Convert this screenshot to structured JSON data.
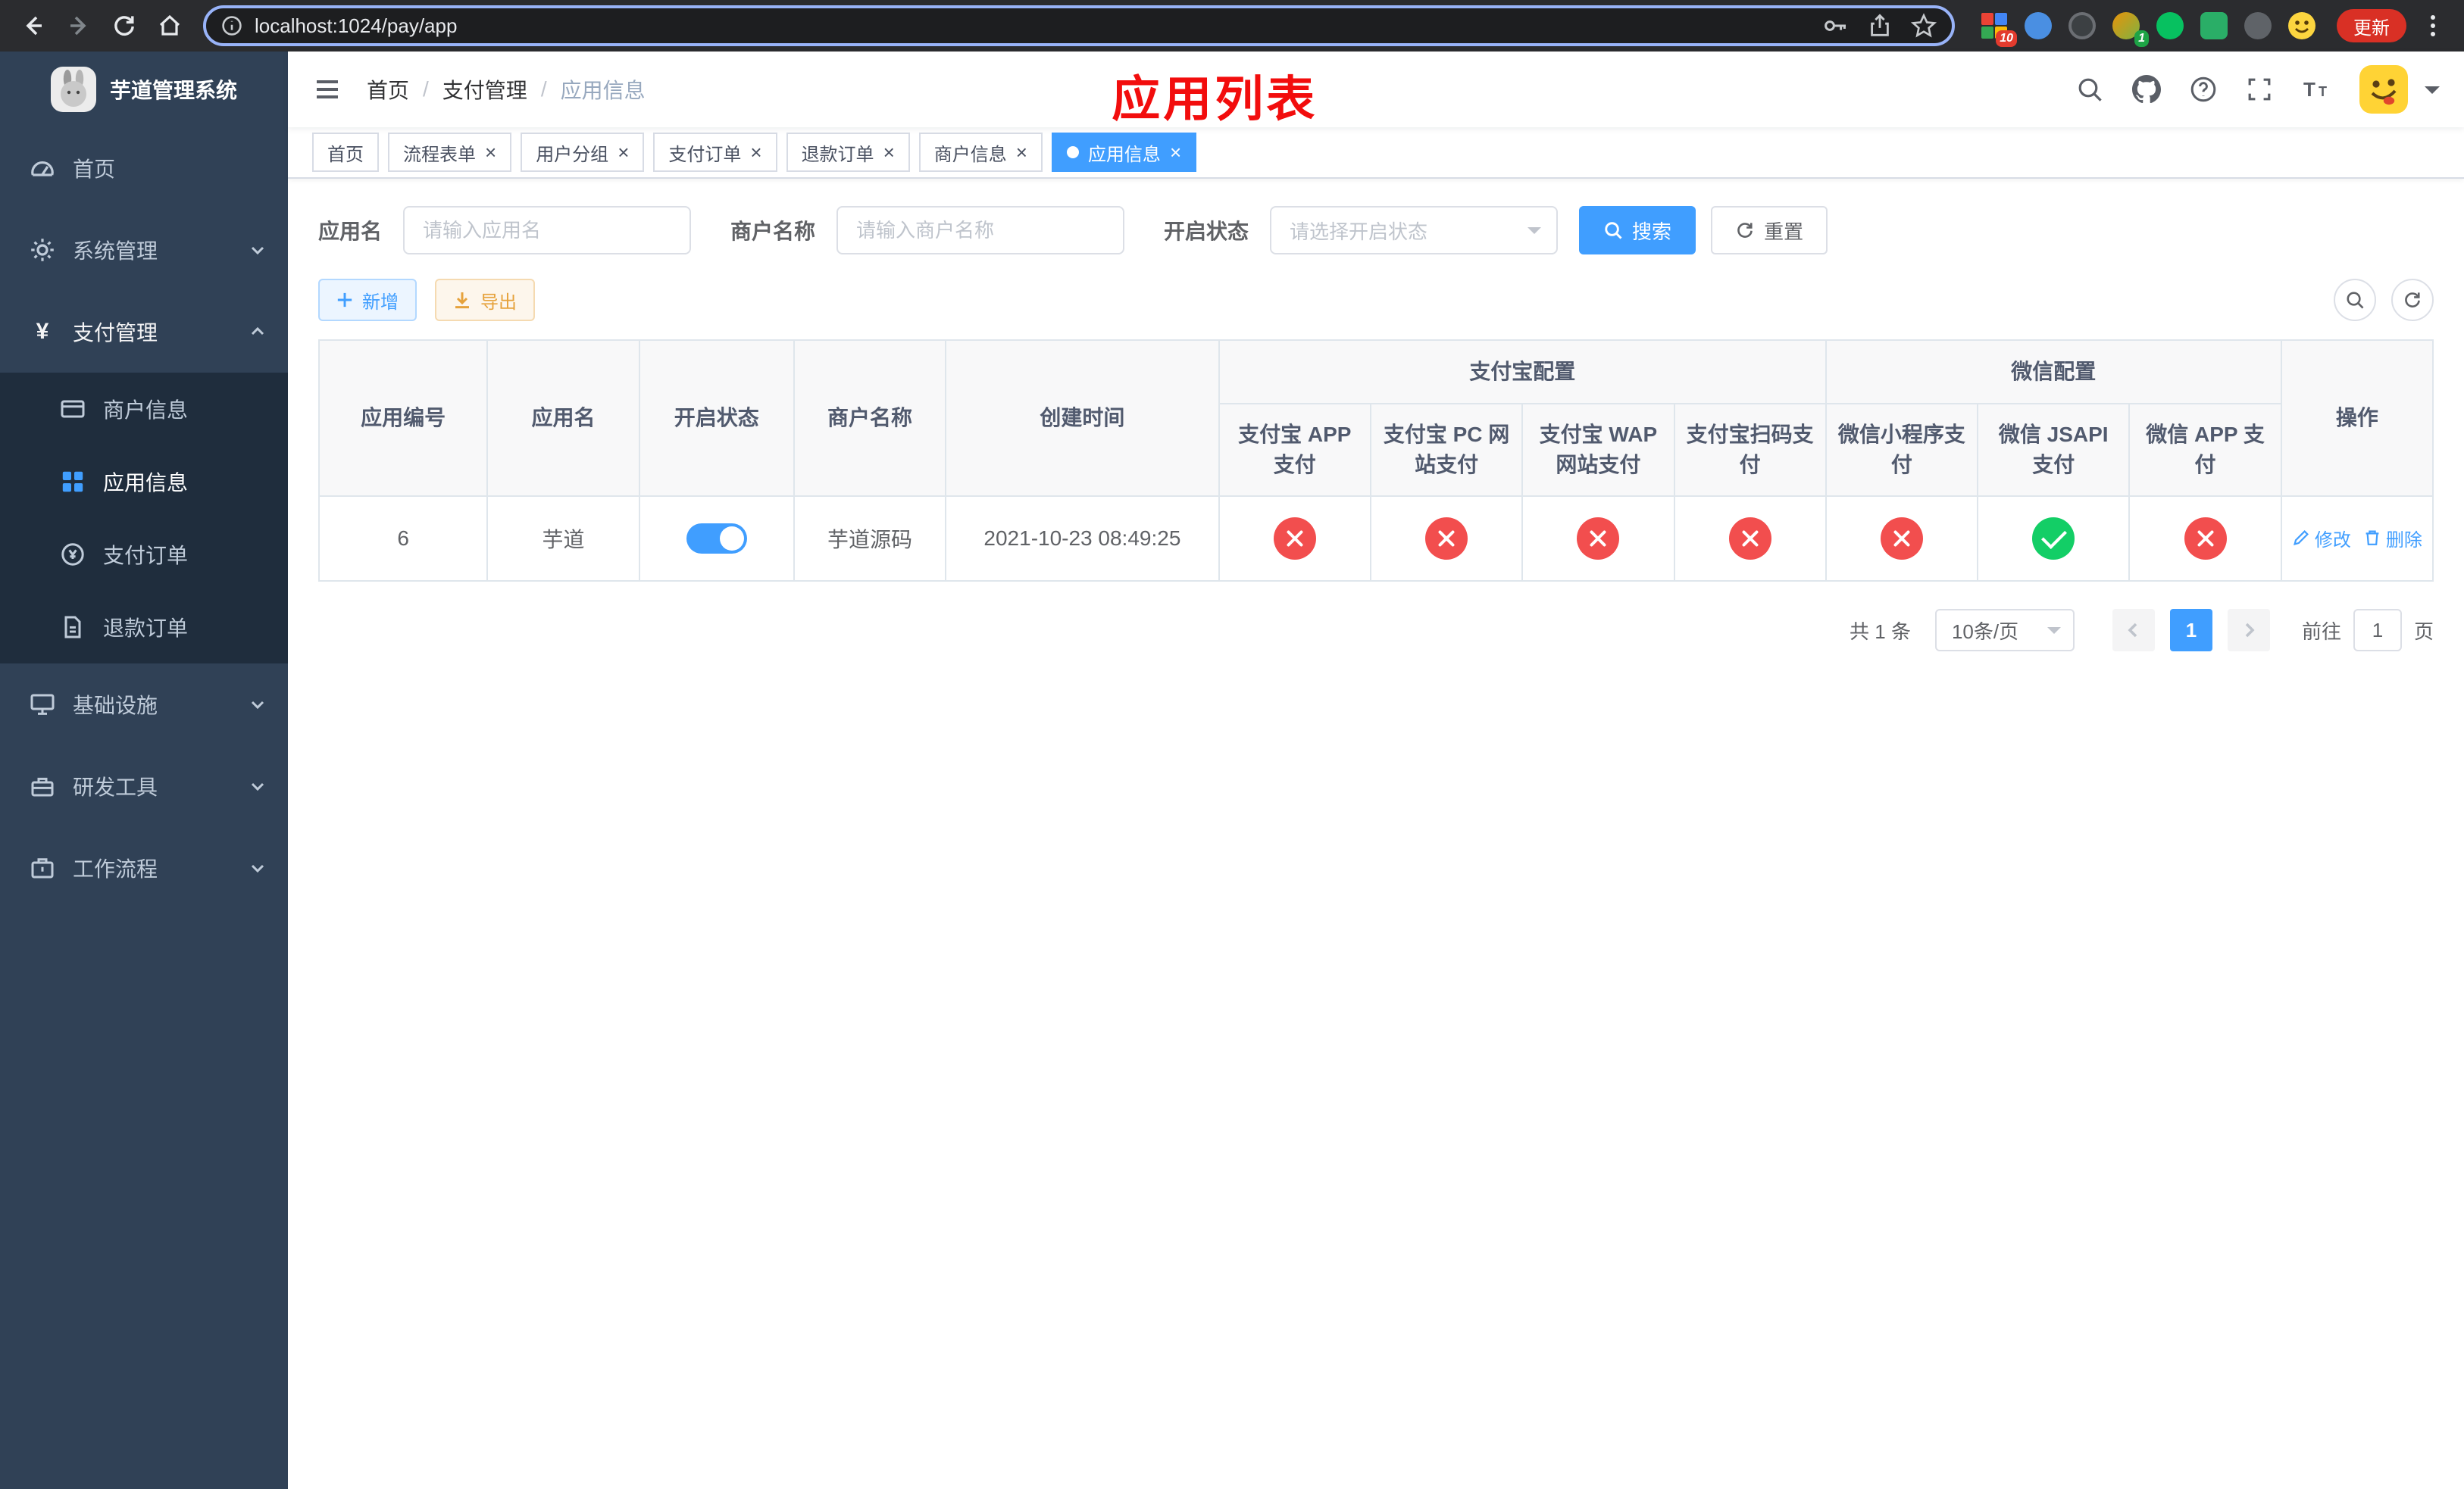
{
  "browser": {
    "url": "localhost:1024/pay/app",
    "update_label": "更新",
    "extension_badges": {
      "grid": "10",
      "avatar": "1"
    }
  },
  "sidebar": {
    "title": "芋道管理系统",
    "items": [
      {
        "label": "首页",
        "icon": "dashboard-icon"
      },
      {
        "label": "系统管理",
        "icon": "gear-icon"
      },
      {
        "label": "支付管理",
        "icon": "yen-icon"
      },
      {
        "label": "基础设施",
        "icon": "monitor-icon"
      },
      {
        "label": "研发工具",
        "icon": "toolbox-icon"
      },
      {
        "label": "工作流程",
        "icon": "briefcase-icon"
      }
    ],
    "payment_children": [
      {
        "label": "商户信息",
        "icon": "credit-card-icon"
      },
      {
        "label": "应用信息",
        "icon": "app-grid-icon"
      },
      {
        "label": "支付订单",
        "icon": "order-icon"
      },
      {
        "label": "退款订单",
        "icon": "refund-doc-icon"
      }
    ]
  },
  "header": {
    "breadcrumb": [
      "首页",
      "支付管理",
      "应用信息"
    ],
    "annotation": "应用列表"
  },
  "tabs": [
    {
      "label": "首页"
    },
    {
      "label": "流程表单"
    },
    {
      "label": "用户分组"
    },
    {
      "label": "支付订单"
    },
    {
      "label": "退款订单"
    },
    {
      "label": "商户信息"
    },
    {
      "label": "应用信息"
    }
  ],
  "filters": {
    "app_name_label": "应用名",
    "app_name_placeholder": "请输入应用名",
    "merchant_label": "商户名称",
    "merchant_placeholder": "请输入商户名称",
    "status_label": "开启状态",
    "status_placeholder": "请选择开启状态",
    "search_label": "搜索",
    "reset_label": "重置"
  },
  "toolbar": {
    "add_label": "新增",
    "export_label": "导出"
  },
  "table": {
    "columns": {
      "id": "应用编号",
      "name": "应用名",
      "status": "开启状态",
      "merchant": "商户名称",
      "created": "创建时间",
      "alipay_group": "支付宝配置",
      "wechat_group": "微信配置",
      "op": "操作"
    },
    "sub_columns": [
      "支付宝 APP 支付",
      "支付宝 PC 网站支付",
      "支付宝 WAP 网站支付",
      "支付宝扫码支付",
      "微信小程序支付",
      "微信 JSAPI 支付",
      "微信 APP 支付"
    ],
    "rows": [
      {
        "id": "6",
        "app_name": "芋道",
        "status_on": true,
        "merchant": "芋道源码",
        "created": "2021-10-23 08:49:25",
        "channels": {
          "alipay_app": false,
          "alipay_pc": false,
          "alipay_wap": false,
          "alipay_qr": false,
          "wx_lite": false,
          "wx_jsapi": true,
          "wx_app": false
        },
        "edit_label": "修改",
        "delete_label": "删除"
      }
    ]
  },
  "pagination": {
    "total_text": "共 1 条",
    "page_size_text": "10条/页",
    "current_page": "1",
    "goto_label": "前往",
    "goto_value": "1",
    "page_unit": "页"
  },
  "colors": {
    "accent": "#409eff",
    "danger": "#f24e4e",
    "success": "#13ce66",
    "sidebar-bg": "#304156",
    "submenu-bg": "#1f2d3d",
    "annotation-red": "#f20d0d"
  }
}
